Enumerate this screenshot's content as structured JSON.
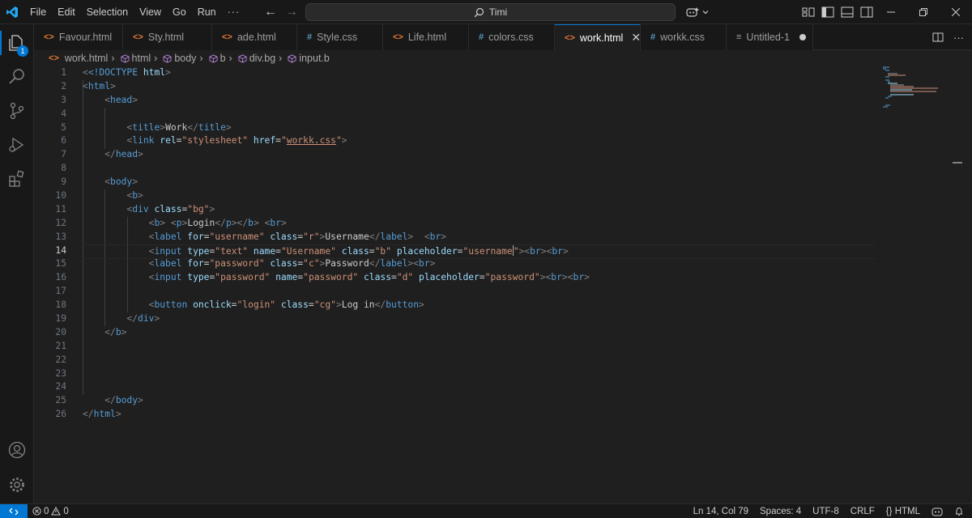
{
  "menu": {
    "items": [
      "File",
      "Edit",
      "Selection",
      "View",
      "Go",
      "Run"
    ],
    "more": "···"
  },
  "command_center": {
    "text": "Timi"
  },
  "tabs": [
    {
      "label": "Favour.html",
      "type": "html"
    },
    {
      "label": "Sty.html",
      "type": "html"
    },
    {
      "label": "ade.html",
      "type": "html"
    },
    {
      "label": "Style.css",
      "type": "css"
    },
    {
      "label": "Life.html",
      "type": "html"
    },
    {
      "label": "colors.css",
      "type": "css"
    },
    {
      "label": "work.html",
      "type": "html",
      "active": true
    },
    {
      "label": "workk.css",
      "type": "css"
    },
    {
      "label": "Untitled-1",
      "type": "plain",
      "dirty": true
    }
  ],
  "tab_icons": {
    "html": "<>",
    "css": "#",
    "plain": "≡"
  },
  "breadcrumb": {
    "file": "work.html",
    "items": [
      "html",
      "body",
      "b",
      "div.bg",
      "input.b"
    ]
  },
  "activity_badge": "1",
  "editor": {
    "current_line": 14,
    "line_numbers": [
      "1",
      "2",
      "3",
      "4",
      "5",
      "6",
      "7",
      "8",
      "9",
      "10",
      "11",
      "12",
      "13",
      "14",
      "15",
      "16",
      "17",
      "18",
      "19",
      "20",
      "21",
      "22",
      "23",
      "24",
      "25",
      "26"
    ]
  },
  "status": {
    "errors": "0",
    "warnings": "0",
    "position": "Ln 14, Col 79",
    "spaces": "Spaces: 4",
    "encoding": "UTF-8",
    "eol": "CRLF",
    "language": "HTML",
    "language_prefix": "{}"
  },
  "colors": {
    "accent": "#0078d4",
    "tag": "#569cd6",
    "attribute": "#9cdcfe",
    "string": "#ce9178",
    "html_icon": "#e37933",
    "css_icon": "#519aba"
  },
  "code": {
    "l1_doctype": "<!DOCTYPE",
    "l1_html": "html",
    "l2": "html",
    "l3": "head",
    "l5_title": "title",
    "l5_text": "Work",
    "l6_link": "link",
    "l6_rel": "rel",
    "l6_rel_val": "\"stylesheet\"",
    "l6_href": "href",
    "l6_href_q1": "\"",
    "l6_href_val": "workk.css",
    "l6_href_q2": "\"",
    "l7": "head",
    "l9": "body",
    "l10": "b",
    "l11_div": "div",
    "l11_class": "class",
    "l11_val": "\"bg\"",
    "l12_b": "b",
    "l12_p": "p",
    "l12_text": "Login",
    "l12_br": "br",
    "l13_label": "label",
    "l13_for": "for",
    "l13_for_val": "\"username\"",
    "l13_class": "class",
    "l13_class_val": "\"r\"",
    "l13_text": "Username",
    "l13_br": "br",
    "l14_input": "input",
    "l14_type": "type",
    "l14_type_val": "\"text\"",
    "l14_name": "name",
    "l14_name_val": "\"Username\"",
    "l14_class": "class",
    "l14_class_val": "\"b\"",
    "l14_ph": "placeholder",
    "l14_ph_val_a": "\"username",
    "l14_ph_val_b": "\"",
    "l15_label": "label",
    "l15_for": "for",
    "l15_for_val": "\"password\"",
    "l15_class": "class",
    "l15_class_val": "\"c\"",
    "l15_text": "Password",
    "l16_input": "input",
    "l16_type": "type",
    "l16_type_val": "\"password\"",
    "l16_name": "name",
    "l16_name_val": "\"password\"",
    "l16_class": "class",
    "l16_class_val": "\"d\"",
    "l16_ph": "placeholder",
    "l16_ph_val": "\"password\"",
    "l18_button": "button",
    "l18_onclick": "onclick",
    "l18_onclick_val": "\"login\"",
    "l18_class": "class",
    "l18_class_val": "\"cg\"",
    "l18_text": "Log in",
    "l19": "div",
    "l20": "b",
    "l25": "body",
    "l26": "html"
  }
}
